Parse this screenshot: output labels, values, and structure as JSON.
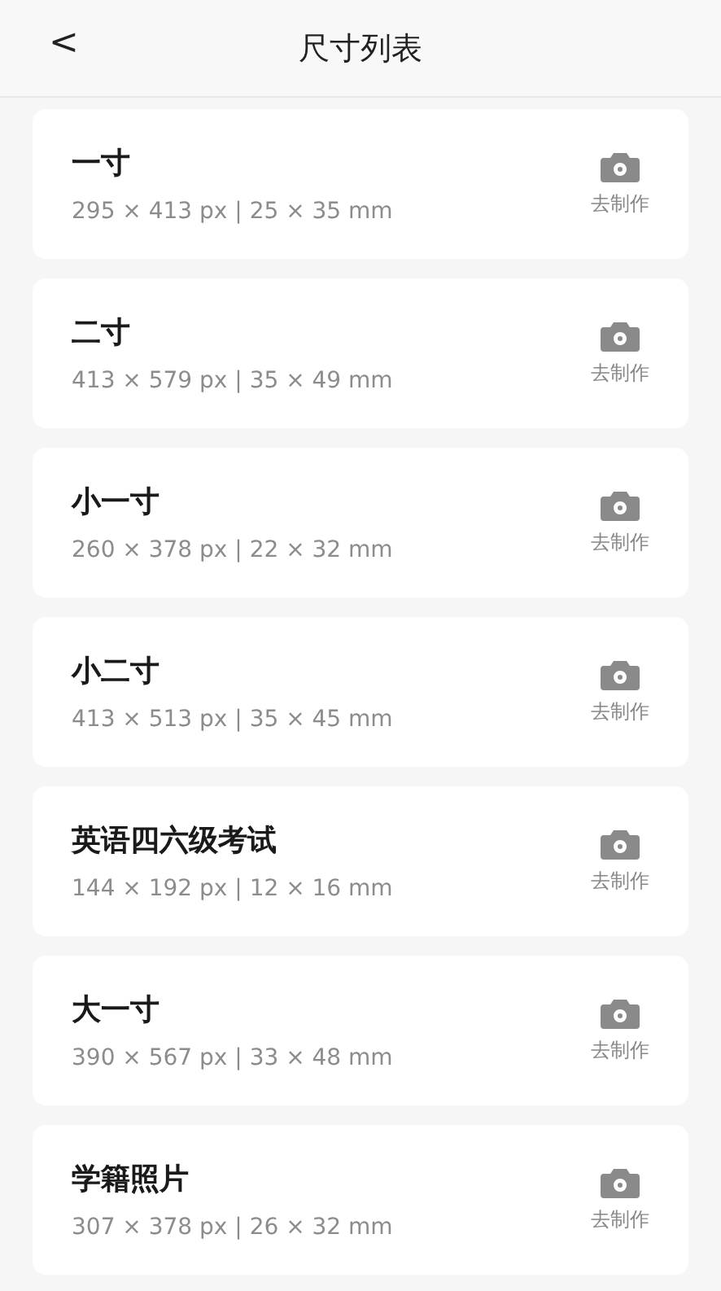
{
  "header": {
    "back": "<",
    "title": "尺寸列表"
  },
  "sizes": [
    {
      "name": "一寸",
      "spec": "295 × 413 px | 25 × 35 mm",
      "action": "去制作"
    },
    {
      "name": "二寸",
      "spec": "413 × 579 px | 35 × 49 mm",
      "action": "去制作"
    },
    {
      "name": "小一寸",
      "spec": "260 × 378 px | 22 × 32 mm",
      "action": "去制作"
    },
    {
      "name": "小二寸",
      "spec": "413 × 513 px | 35 × 45 mm",
      "action": "去制作"
    },
    {
      "name": "英语四六级考试",
      "spec": "144 × 192 px | 12 × 16 mm",
      "action": "去制作"
    },
    {
      "name": "大一寸",
      "spec": "390 × 567 px | 33 × 48 mm",
      "action": "去制作"
    },
    {
      "name": "学籍照片",
      "spec": "307 × 378 px | 26 × 32 mm",
      "action": "去制作"
    }
  ]
}
